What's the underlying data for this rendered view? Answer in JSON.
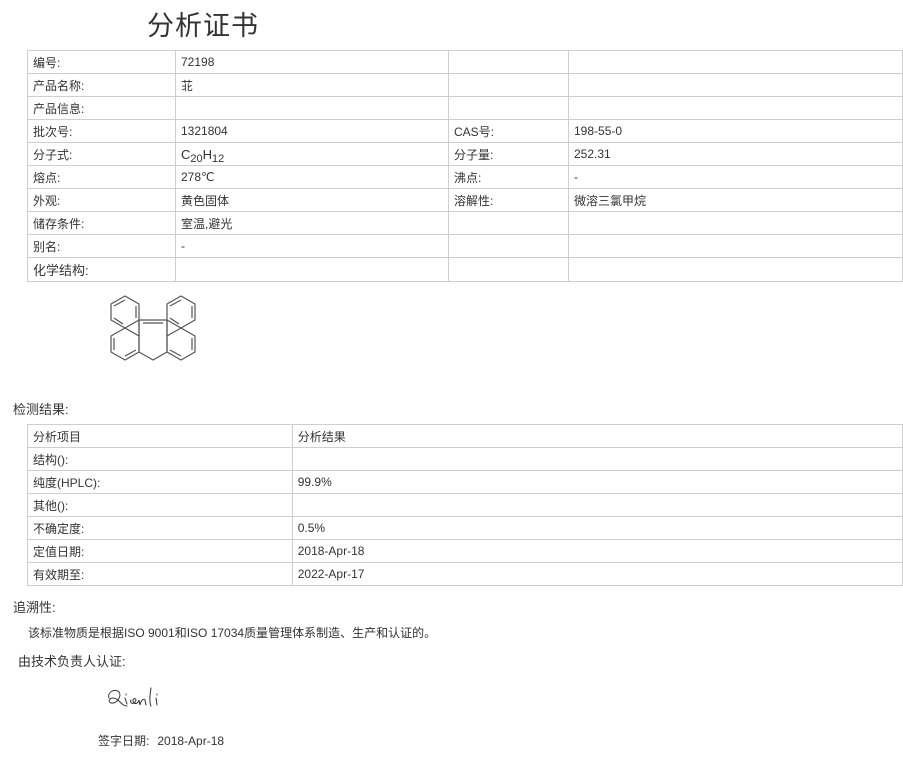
{
  "title": "分析证书",
  "info": {
    "rows": [
      {
        "label": "编号:",
        "value": "72198",
        "label2": "",
        "value2": ""
      },
      {
        "label": "产品名称:",
        "value": "苝",
        "label2": "",
        "value2": ""
      },
      {
        "label": "产品信息:",
        "value": "",
        "label2": "",
        "value2": ""
      },
      {
        "label": "批次号:",
        "value": "1321804",
        "label2": "CAS号:",
        "value2": "198-55-0"
      },
      {
        "label": "分子式:",
        "value": "",
        "label2": "分子量:",
        "value2": "252.31"
      },
      {
        "label": "熔点:",
        "value": "278℃",
        "label2": "沸点:",
        "value2": "-"
      },
      {
        "label": "外观:",
        "value": "黄色固体",
        "label2": "溶解性:",
        "value2": "微溶三氯甲烷"
      },
      {
        "label": "储存条件:",
        "value": "室温,避光",
        "label2": "",
        "value2": ""
      },
      {
        "label": "别名:",
        "value": "-",
        "label2": "",
        "value2": ""
      },
      {
        "label": "化学结构:",
        "value": "",
        "label2": "",
        "value2": ""
      }
    ],
    "formula": {
      "c": "C",
      "c_count": "20",
      "h": "H",
      "h_count": "12"
    }
  },
  "results": {
    "heading": "检测结果:",
    "header": {
      "item": "分析项目",
      "result": "分析结果"
    },
    "rows": [
      {
        "item": "结构():",
        "result": ""
      },
      {
        "item": "纯度(HPLC):",
        "result": "99.9%"
      },
      {
        "item": "其他():",
        "result": ""
      },
      {
        "item": "不确定度:",
        "result": "0.5%"
      },
      {
        "item": "定值日期:",
        "result": "2018-Apr-18"
      },
      {
        "item": "有效期至:",
        "result": "2022-Apr-17"
      }
    ]
  },
  "traceability": {
    "heading": "追溯性:",
    "text": "该标准物质是根据ISO 9001和ISO 17034质量管理体系制造、生产和认证的。"
  },
  "certification": {
    "heading": "由技术负责人认证:",
    "signature": "Qianli",
    "sign_date_label": "签字日期:",
    "sign_date": "2018-Apr-18"
  }
}
